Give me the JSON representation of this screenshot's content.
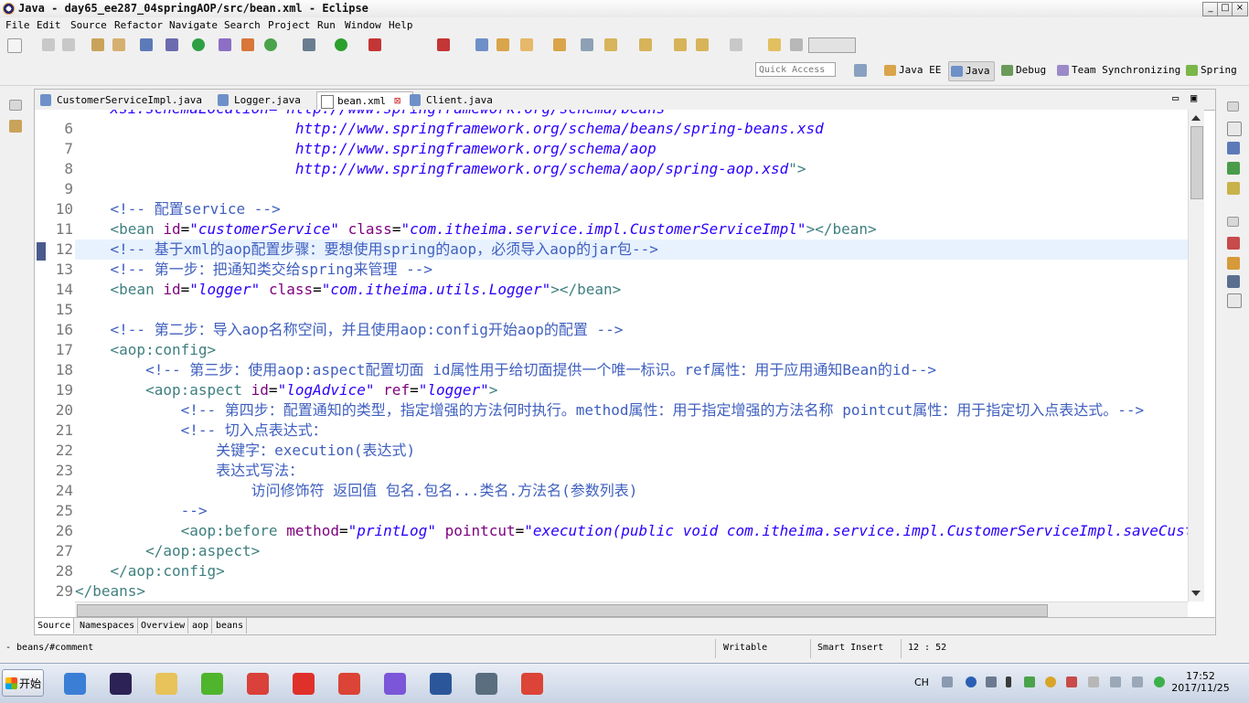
{
  "window": {
    "title": "Java - day65_ee287_04springAOP/src/bean.xml - Eclipse",
    "min": "_",
    "max": "□",
    "close": "×"
  },
  "menubar": [
    "File",
    "Edit",
    "Source",
    "Refactor",
    "Navigate",
    "Search",
    "Project",
    "Run",
    "Window",
    "Help"
  ],
  "quick_access": {
    "placeholder": "Quick Access"
  },
  "perspectives": [
    {
      "label": "Java EE",
      "icon": "java-ee-icon",
      "active": false
    },
    {
      "label": "Java",
      "icon": "java-icon",
      "active": true
    },
    {
      "label": "Debug",
      "icon": "bug-icon",
      "active": false
    },
    {
      "label": "Team Synchronizing",
      "icon": "team-sync-icon",
      "active": false
    },
    {
      "label": "Spring",
      "icon": "spring-icon",
      "active": false
    }
  ],
  "tabs": [
    {
      "label": "CustomerServiceImpl.java",
      "icon": "java-file-icon",
      "active": false
    },
    {
      "label": "Logger.java",
      "icon": "java-file-icon",
      "active": false
    },
    {
      "label": "bean.xml",
      "icon": "xml-file-icon",
      "active": true,
      "close": "⊠"
    },
    {
      "label": "Client.java",
      "icon": "java-file-icon",
      "active": false
    }
  ],
  "editor_controls": {
    "minimize": "▭",
    "maximize": "▣"
  },
  "code": {
    "line5_partial": "    xsi:schemaLocation=\"http://www.springframework.org/schema/beans",
    "lines": [
      {
        "n": "6",
        "indent": "                         ",
        "segments": [
          {
            "c": "vl",
            "t": "http://www.springframework.org/schema/beans/spring-beans.xsd"
          }
        ]
      },
      {
        "n": "7",
        "indent": "                         ",
        "segments": [
          {
            "c": "vl",
            "t": "http://www.springframework.org/schema/aop"
          }
        ]
      },
      {
        "n": "8",
        "indent": "                         ",
        "segments": [
          {
            "c": "vl",
            "t": "http://www.springframework.org/schema/aop/spring-aop.xsd"
          },
          {
            "c": "tg",
            "t": "\">"
          }
        ]
      },
      {
        "n": "9",
        "indent": "",
        "segments": []
      },
      {
        "n": "10",
        "indent": "    ",
        "segments": [
          {
            "c": "cm",
            "t": "<!-- 配置service -->"
          }
        ]
      },
      {
        "n": "11",
        "indent": "    ",
        "segments": [
          {
            "c": "tg",
            "t": "<bean "
          },
          {
            "c": "at",
            "t": "id"
          },
          {
            "c": "tx",
            "t": "="
          },
          {
            "c": "vl",
            "t": "\"customerService\""
          },
          {
            "c": "tx",
            "t": " "
          },
          {
            "c": "at",
            "t": "class"
          },
          {
            "c": "tx",
            "t": "="
          },
          {
            "c": "vl",
            "t": "\"com.itheima.service.impl.CustomerServiceImpl\""
          },
          {
            "c": "tg",
            "t": "></bean>"
          }
        ]
      },
      {
        "n": "12",
        "indent": "    ",
        "current": true,
        "segments": [
          {
            "c": "cm",
            "t": "<!-- 基于xml的aop配置步骤：要想使用spring的aop，必须导入aop的jar包-->"
          }
        ]
      },
      {
        "n": "13",
        "indent": "    ",
        "segments": [
          {
            "c": "cm",
            "t": "<!-- 第一步：把通知类交给spring来管理 -->"
          }
        ]
      },
      {
        "n": "14",
        "indent": "    ",
        "segments": [
          {
            "c": "tg",
            "t": "<bean "
          },
          {
            "c": "at",
            "t": "id"
          },
          {
            "c": "tx",
            "t": "="
          },
          {
            "c": "vl",
            "t": "\"logger\""
          },
          {
            "c": "tx",
            "t": " "
          },
          {
            "c": "at",
            "t": "class"
          },
          {
            "c": "tx",
            "t": "="
          },
          {
            "c": "vl",
            "t": "\"com.itheima.utils.Logger\""
          },
          {
            "c": "tg",
            "t": "></bean>"
          }
        ]
      },
      {
        "n": "15",
        "indent": "",
        "segments": []
      },
      {
        "n": "16",
        "indent": "    ",
        "segments": [
          {
            "c": "cm",
            "t": "<!-- 第二步：导入aop名称空间，并且使用aop:config开始aop的配置 -->"
          }
        ]
      },
      {
        "n": "17",
        "indent": "    ",
        "segments": [
          {
            "c": "tg",
            "t": "<aop:config>"
          }
        ]
      },
      {
        "n": "18",
        "indent": "        ",
        "segments": [
          {
            "c": "cm",
            "t": "<!-- 第三步：使用aop:aspect配置切面 id属性用于给切面提供一个唯一标识。ref属性：用于应用通知Bean的id-->"
          }
        ]
      },
      {
        "n": "19",
        "indent": "        ",
        "segments": [
          {
            "c": "tg",
            "t": "<aop:aspect "
          },
          {
            "c": "at",
            "t": "id"
          },
          {
            "c": "tx",
            "t": "="
          },
          {
            "c": "vl",
            "t": "\"logAdvice\""
          },
          {
            "c": "tx",
            "t": " "
          },
          {
            "c": "at",
            "t": "ref"
          },
          {
            "c": "tx",
            "t": "="
          },
          {
            "c": "vl",
            "t": "\"logger\""
          },
          {
            "c": "tg",
            "t": ">"
          }
        ]
      },
      {
        "n": "20",
        "indent": "            ",
        "segments": [
          {
            "c": "cm",
            "t": "<!-- 第四步：配置通知的类型，指定增强的方法何时执行。method属性：用于指定增强的方法名称 pointcut属性：用于指定切入点表达式。-->"
          }
        ]
      },
      {
        "n": "21",
        "indent": "            ",
        "segments": [
          {
            "c": "cm",
            "t": "<!-- 切入点表达式："
          }
        ]
      },
      {
        "n": "22",
        "indent": "                ",
        "segments": [
          {
            "c": "cm",
            "t": "关键字：execution(表达式)"
          }
        ]
      },
      {
        "n": "23",
        "indent": "                ",
        "segments": [
          {
            "c": "cm",
            "t": "表达式写法："
          }
        ]
      },
      {
        "n": "24",
        "indent": "                    ",
        "segments": [
          {
            "c": "cm",
            "t": "访问修饰符 返回值 包名.包名...类名.方法名(参数列表)"
          }
        ]
      },
      {
        "n": "25",
        "indent": "            ",
        "segments": [
          {
            "c": "cm",
            "t": "-->"
          }
        ]
      },
      {
        "n": "26",
        "indent": "            ",
        "segments": [
          {
            "c": "tg",
            "t": "<aop:before "
          },
          {
            "c": "at",
            "t": "method"
          },
          {
            "c": "tx",
            "t": "="
          },
          {
            "c": "vl",
            "t": "\"printLog\""
          },
          {
            "c": "tx",
            "t": " "
          },
          {
            "c": "at",
            "t": "pointcut"
          },
          {
            "c": "tx",
            "t": "="
          },
          {
            "c": "vl",
            "t": "\"execution(public void com.itheima.service.impl.CustomerServiceImpl.saveCustomer())\""
          },
          {
            "c": "tg",
            "t": "></aop:before>"
          }
        ]
      },
      {
        "n": "27",
        "indent": "        ",
        "segments": [
          {
            "c": "tg",
            "t": "</aop:aspect>"
          }
        ]
      },
      {
        "n": "28",
        "indent": "    ",
        "segments": [
          {
            "c": "tg",
            "t": "</aop:config>"
          }
        ]
      },
      {
        "n": "29",
        "indent": "",
        "segments": [
          {
            "c": "tg",
            "t": "</beans>"
          }
        ]
      }
    ]
  },
  "bottom_tabs": [
    "Source",
    "Namespaces",
    "Overview",
    "aop",
    "beans"
  ],
  "status": {
    "path": "- beans/#comment",
    "mode": "Writable",
    "insert": "Smart Insert",
    "position": "12 : 52"
  },
  "taskbar": {
    "start_label": "开始",
    "ime": "CH",
    "time": "17:52",
    "date": "2017/11/25",
    "apps": [
      {
        "name": "remote-desktop-icon",
        "color": "#3a7fd5"
      },
      {
        "name": "eclipse-icon",
        "color": "#2c2255"
      },
      {
        "name": "file-explorer-icon",
        "color": "#e8c25a"
      },
      {
        "name": "green-app-icon",
        "color": "#4fb52d"
      },
      {
        "name": "red-app-icon",
        "color": "#d9413a"
      },
      {
        "name": "red-g-icon",
        "color": "#e0302a"
      },
      {
        "name": "chrome-icon",
        "color": "#db4437"
      },
      {
        "name": "color-wheel-icon",
        "color": "#7b56d8"
      },
      {
        "name": "word-icon",
        "color": "#2b579a"
      },
      {
        "name": "document-viewer-icon",
        "color": "#5a6e7f"
      },
      {
        "name": "chrome-icon-2",
        "color": "#db4437"
      }
    ]
  }
}
